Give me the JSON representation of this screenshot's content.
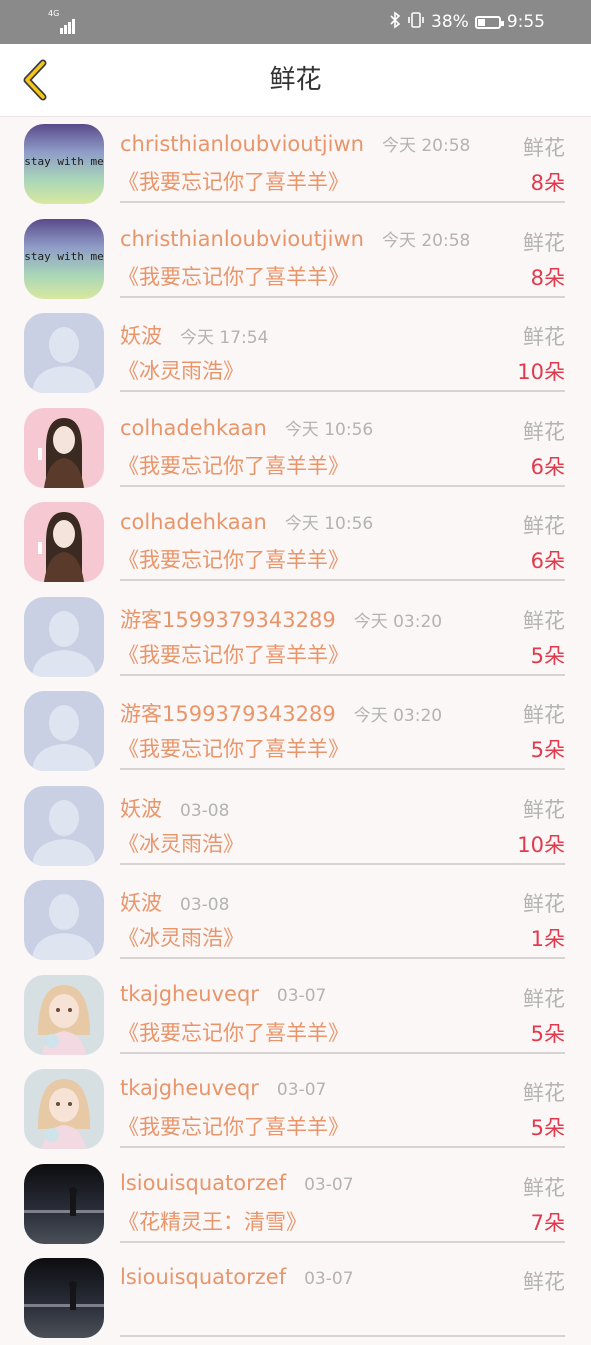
{
  "status_bar": {
    "network": "4G",
    "battery": "38%",
    "time": "9:55",
    "battery_level": 0.38
  },
  "header": {
    "title": "鲜花",
    "back_icon": "chevron-left-icon",
    "accent": "#f5c518"
  },
  "colors": {
    "name": "#e9956a",
    "count": "#e23a4c",
    "meta": "#b3b3b3"
  },
  "rows": [
    {
      "avatar": "stay-with-me",
      "avatar_text": "stay with me",
      "name": "christhianloubvioutjiwn",
      "time": "今天 20:58",
      "kind": "鲜花",
      "book": "《我要忘记你了喜羊羊》",
      "count": "8朵"
    },
    {
      "avatar": "stay-with-me",
      "avatar_text": "stay with me",
      "name": "christhianloubvioutjiwn",
      "time": "今天 20:58",
      "kind": "鲜花",
      "book": "《我要忘记你了喜羊羊》",
      "count": "8朵"
    },
    {
      "avatar": "default",
      "name": "妖波",
      "time": "今天 17:54",
      "kind": "鲜花",
      "book": "《冰灵雨浩》",
      "count": "10朵"
    },
    {
      "avatar": "girl-sketch",
      "name": "colhadehkaan",
      "time": "今天 10:56",
      "kind": "鲜花",
      "book": "《我要忘记你了喜羊羊》",
      "count": "6朵"
    },
    {
      "avatar": "girl-sketch",
      "name": "colhadehkaan",
      "time": "今天 10:56",
      "kind": "鲜花",
      "book": "《我要忘记你了喜羊羊》",
      "count": "6朵"
    },
    {
      "avatar": "default",
      "name": "游客1599379343289",
      "time": "今天 03:20",
      "kind": "鲜花",
      "book": "《我要忘记你了喜羊羊》",
      "count": "5朵"
    },
    {
      "avatar": "default",
      "name": "游客1599379343289",
      "time": "今天 03:20",
      "kind": "鲜花",
      "book": "《我要忘记你了喜羊羊》",
      "count": "5朵"
    },
    {
      "avatar": "default",
      "name": "妖波",
      "time": "03-08",
      "kind": "鲜花",
      "book": "《冰灵雨浩》",
      "count": "10朵"
    },
    {
      "avatar": "default",
      "name": "妖波",
      "time": "03-08",
      "kind": "鲜花",
      "book": "《冰灵雨浩》",
      "count": "1朵"
    },
    {
      "avatar": "doll-girl",
      "name": "tkajgheuveqr",
      "time": "03-07",
      "kind": "鲜花",
      "book": "《我要忘记你了喜羊羊》",
      "count": "5朵"
    },
    {
      "avatar": "doll-girl",
      "name": "tkajgheuveqr",
      "time": "03-07",
      "kind": "鲜花",
      "book": "《我要忘记你了喜羊羊》",
      "count": "5朵"
    },
    {
      "avatar": "night-city",
      "name": "lsiouisquatorzef",
      "time": "03-07",
      "kind": "鲜花",
      "book": "《花精灵王：清雪》",
      "count": "7朵"
    },
    {
      "avatar": "night-city",
      "name": "lsiouisquatorzef",
      "time": "03-07",
      "kind": "鲜花",
      "book": "",
      "count": ""
    }
  ]
}
